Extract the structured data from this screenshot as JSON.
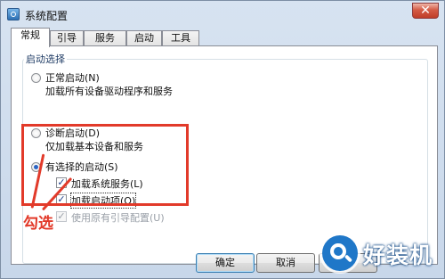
{
  "window": {
    "title": "系统配置",
    "close_glyph": "✕"
  },
  "tabs": [
    {
      "label": "常规",
      "active": true
    },
    {
      "label": "引导"
    },
    {
      "label": "服务"
    },
    {
      "label": "启动"
    },
    {
      "label": "工具"
    }
  ],
  "startup": {
    "group_label": "启动选择",
    "normal": {
      "label": "正常启动(N)",
      "desc": "加载所有设备驱动程序和服务",
      "selected": false
    },
    "diagnostic": {
      "label": "诊断启动(D)",
      "desc": "仅加载基本设备和服务",
      "selected": false
    },
    "selective": {
      "label": "有选择的启动(S)",
      "selected": true,
      "options": [
        {
          "label": "加载系统服务(L)",
          "checked": true,
          "enabled": true
        },
        {
          "label": "加载启动项(O)",
          "checked": true,
          "enabled": true
        },
        {
          "label": "使用原有引导配置(U)",
          "checked": true,
          "enabled": false
        }
      ]
    }
  },
  "buttons": {
    "ok": "确定",
    "cancel": "取消"
  },
  "annotation": {
    "text": "勾选",
    "color": "#e23a2a"
  },
  "watermark": {
    "text": "好装机"
  },
  "icons": {
    "app": "settings-app-icon",
    "close": "close-icon",
    "watermark": "search-logo-icon"
  }
}
